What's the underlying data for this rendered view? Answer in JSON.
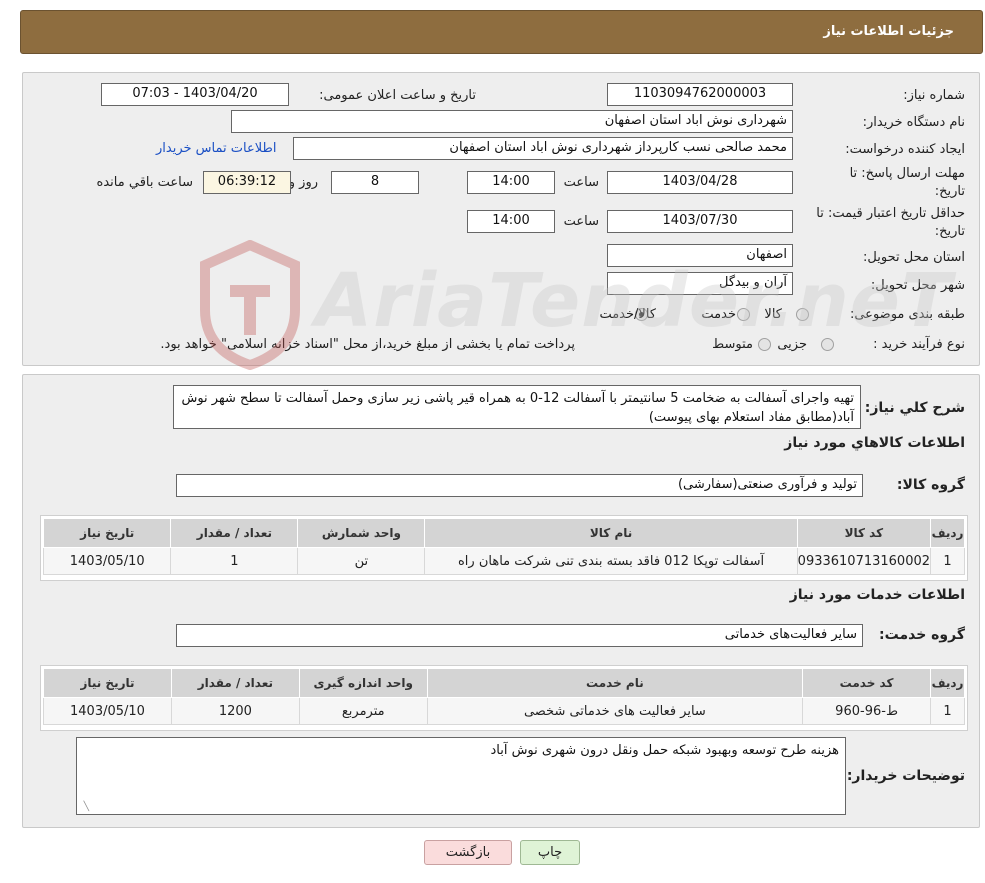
{
  "header": {
    "title": "جزئیات اطلاعات نیاز"
  },
  "form": {
    "need_number_label": "شماره نیاز:",
    "need_number": "1103094762000003",
    "announce_label": "تاریخ و ساعت اعلان عمومی:",
    "announce_value": "1403/04/20 - 07:03",
    "buyer_org_label": "نام دستگاه خریدار:",
    "buyer_org": "شهرداری نوش اباد استان اصفهان",
    "requester_label": "ایجاد کننده درخواست:",
    "requester": "محمد صالحی نسب کارپرداز شهرداری نوش اباد استان اصفهان",
    "contact_link": "اطلاعات تماس خریدار",
    "reply_deadline_label_1": "مهلت ارسال پاسخ: تا",
    "reply_deadline_label_2": "تاریخ:",
    "reply_date": "1403/04/28",
    "time_label": "ساعت",
    "reply_time": "14:00",
    "days_value": "8",
    "days_label": "روز و",
    "remaining_time": "06:39:12",
    "remaining_label": "ساعت باقي مانده",
    "validity_label_1": "حداقل تاریخ اعتبار قیمت: تا",
    "validity_label_2": "تاریخ:",
    "validity_date": "1403/07/30",
    "validity_time": "14:00",
    "province_label": "استان محل تحویل:",
    "province": "اصفهان",
    "city_label": "شهر محل تحویل:",
    "city": "آران و بیدگل",
    "category_label": "طبقه بندی موضوعی:",
    "category_options": [
      "کالا",
      "خدمت",
      "کالا/خدمت"
    ],
    "category_selected": "کالا/خدمت",
    "process_label": "نوع فرآیند خرید :",
    "process_options": [
      "جزیی",
      "متوسط"
    ],
    "process_note": "پرداخت تمام یا بخشی از مبلغ خرید،از محل \"اسناد خزانه اسلامی\" خواهد بود."
  },
  "description": {
    "label": "شرح کلي نياز:",
    "text": "تهیه واجرای آسفالت به ضخامت 5 سانتیمتر با آسفالت 12-0 به همراه قیر پاشی زیر سازی وحمل آسفالت تا سطح شهر نوش آباد(مطابق مفاد استعلام بهای پیوست)"
  },
  "goods": {
    "section_title": "اطلاعات کالاهاي مورد نياز",
    "group_label": "گروه کالا:",
    "group_value": "تولید و فرآوری صنعتی(سفارشی)",
    "columns": [
      "رديف",
      "کد کالا",
      "نام کالا",
      "واحد شمارش",
      "تعداد / مقدار",
      "تاریخ نیاز"
    ],
    "rows": [
      [
        "1",
        "0933610713160002",
        "آسفالت توپکا 012 فاقد بسته بندی تنی شرکت ماهان راه",
        "تن",
        "1",
        "1403/05/10"
      ]
    ]
  },
  "services": {
    "section_title": "اطلاعات خدمات مورد نياز",
    "group_label": "گروه خدمت:",
    "group_value": "سایر فعالیت‌های خدماتی",
    "columns": [
      "رديف",
      "کد خدمت",
      "نام خدمت",
      "واحد اندازه گیری",
      "تعداد / مقدار",
      "تاریخ نیاز"
    ],
    "rows": [
      [
        "1",
        "ط-96-960",
        "سایر فعالیت های خدماتی شخصی",
        "مترمربع",
        "1200",
        "1403/05/10"
      ]
    ]
  },
  "buyer_notes": {
    "label": "توضیحات خریدار:",
    "text": "هزینه طرح توسعه وبهبود شبکه حمل ونقل درون شهری نوش آباد"
  },
  "buttons": {
    "print": "چاپ",
    "back": "بازگشت"
  },
  "watermark": {
    "text": "AriaTender.neT"
  },
  "colors": {
    "header_bg": "#8e6d3f",
    "link": "#1a4fc4",
    "panel_bg": "#eeeeee"
  }
}
